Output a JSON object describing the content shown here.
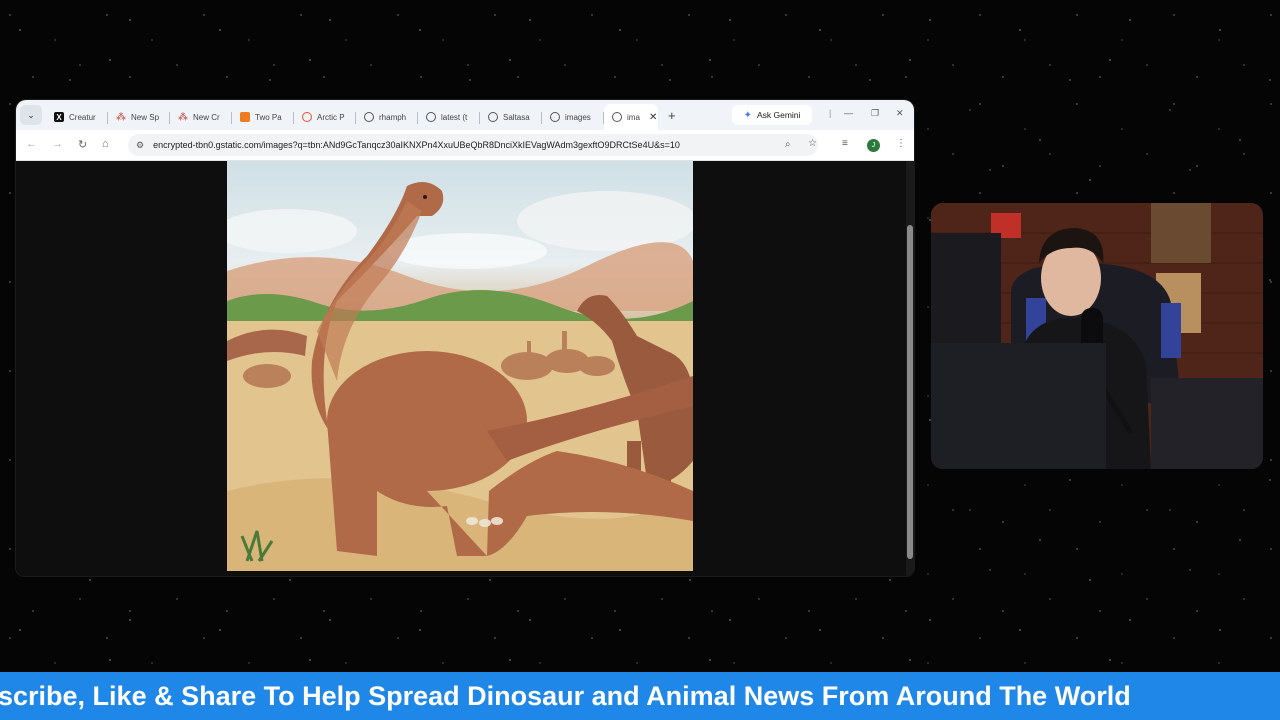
{
  "browser": {
    "tabs": [
      {
        "label": "Creatur",
        "icon": "x-logo-icon"
      },
      {
        "label": "New Sp",
        "icon": "ai-logo-icon"
      },
      {
        "label": "New Cr",
        "icon": "ai-logo-icon"
      },
      {
        "label": "Two Pa",
        "icon": "orange-logo-icon"
      },
      {
        "label": "Arctic P",
        "icon": "arctic-logo-icon"
      },
      {
        "label": "rhamph",
        "icon": "globe-icon"
      },
      {
        "label": "latest (t",
        "icon": "globe-icon"
      },
      {
        "label": "Saltasa",
        "icon": "globe-icon"
      },
      {
        "label": "images",
        "icon": "globe-icon"
      },
      {
        "label": "ima",
        "icon": "globe-icon",
        "active": true
      }
    ],
    "gemini_label": "Ask Gemini",
    "url": "encrypted-tbn0.gstatic.com/images?q=tbn:ANd9GcTanqcz30aIKNXPn4XxuUBeQbR8DnciXkIEVagWAdm3gexftO9DRCtSe4U&s=10",
    "avatar_letter": "J"
  },
  "ticker": {
    "text": "scribe, Like & Share To Help Spread Dinosaur and Animal News From Around The World"
  },
  "colors": {
    "ticker_bg": "#1e87e8",
    "background": "#050505"
  }
}
